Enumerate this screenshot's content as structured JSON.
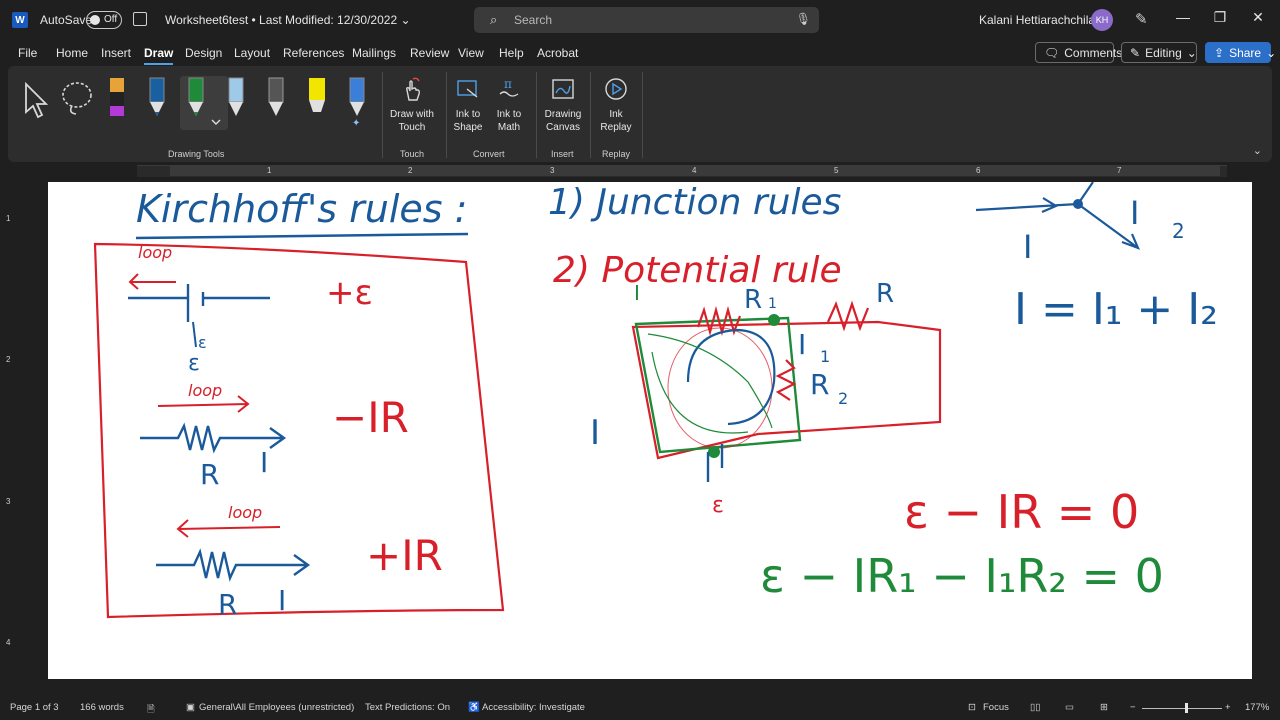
{
  "titlebar": {
    "word_icon": "W",
    "autosave_label": "AutoSave",
    "autosave_state": "Off",
    "document_title": "Worksheet6test • Last Modified: 12/30/2022",
    "search_placeholder": "Search",
    "user_name": "Kalani Hettiarachchilage",
    "user_initials": "KH"
  },
  "tabs": [
    "File",
    "Home",
    "Insert",
    "Draw",
    "Design",
    "Layout",
    "References",
    "Mailings",
    "Review",
    "View",
    "Help",
    "Acrobat"
  ],
  "active_tab": "Draw",
  "right_buttons": {
    "comments": "Comments",
    "editing": "Editing",
    "share": "Share"
  },
  "ribbon": {
    "groups": {
      "drawing_tools": "Drawing Tools",
      "touch": "Touch",
      "convert": "Convert",
      "insert": "Insert",
      "replay": "Replay"
    },
    "commands": {
      "draw_with_touch": "Draw with Touch",
      "ink_to_shape": "Ink to Shape",
      "ink_to_math": "Ink to Math",
      "drawing_canvas": "Drawing Canvas",
      "ink_replay": "Ink Replay"
    },
    "pen_colors": [
      "#222222",
      "#e8a23a",
      "#1a5fa0",
      "#1e8a3a",
      "#9ec9e8",
      "#dddddd",
      "#f2e600",
      "#3b7fd8"
    ]
  },
  "ruler": {
    "h_numbers": [
      "1",
      "2",
      "3",
      "4",
      "5",
      "6",
      "7"
    ],
    "v_numbers": [
      "1",
      "2",
      "3",
      "4"
    ]
  },
  "ink": {
    "title": "Kirchhoff's rules :",
    "junction_rule": "1) Junction rules",
    "potential_rule": "2) Potential rule",
    "loop_label": "loop",
    "emf_plus": "+ε",
    "emf_symbol": "ε",
    "minus_IR": "−IR",
    "plus_IR": "+IR",
    "R": "R",
    "I": "I",
    "I1": "I",
    "I2": "I",
    "sub1": "1",
    "sub2": "2",
    "R1": "R",
    "R2": "R",
    "R3": "R",
    "junction_equation": "I = I₁ + I₂",
    "eq1": "ε − IR = 0",
    "eq2": "ε − IR₁ − I₁R₂ = 0",
    "colors": {
      "blue": "#1a5a9a",
      "red": "#d8202a",
      "green": "#1e8a3a"
    }
  },
  "status": {
    "page": "Page 1 of 3",
    "words": "166 words",
    "sensitivity": "General\\All Employees (unrestricted)",
    "predictions": "Text Predictions: On",
    "accessibility": "Accessibility: Investigate",
    "focus": "Focus",
    "zoom": "177%"
  }
}
